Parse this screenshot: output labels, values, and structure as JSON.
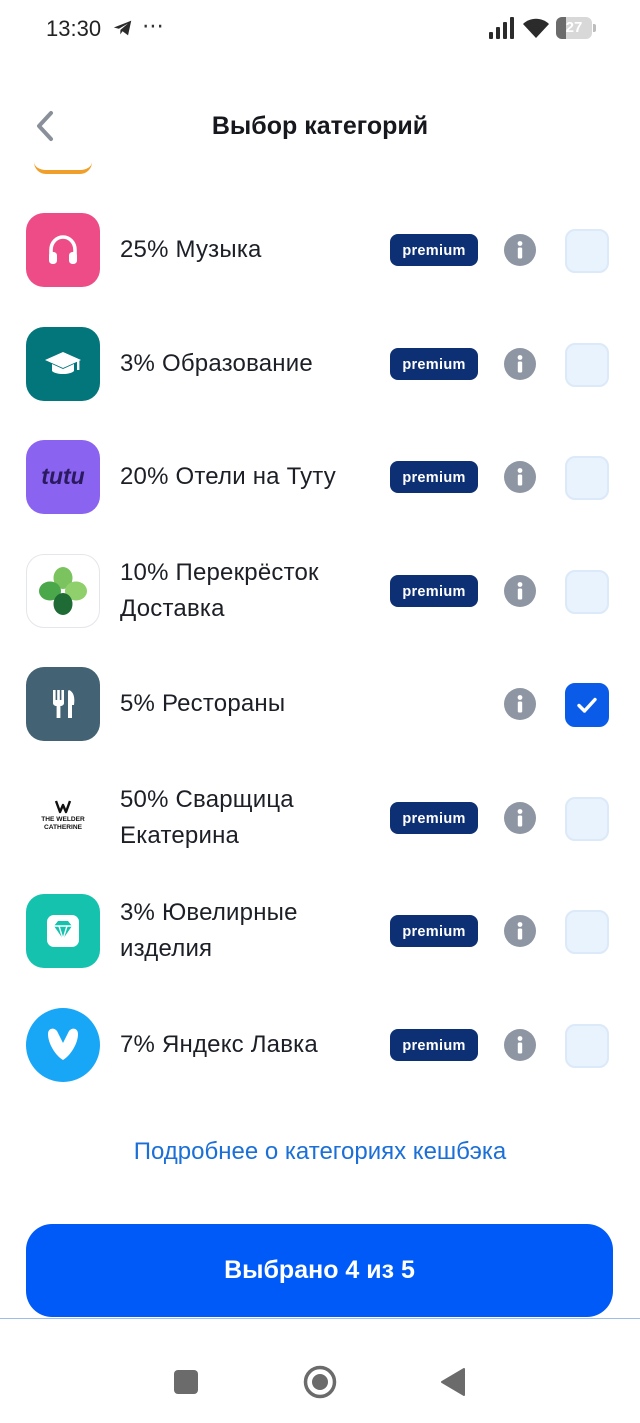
{
  "status_bar": {
    "time": "13:30",
    "more_icon": "⋯",
    "battery_level": "27",
    "battery_fraction": 0.27,
    "icons": [
      "telegram-icon",
      "more-dots-icon",
      "signal-icon",
      "wifi-icon",
      "battery-icon"
    ]
  },
  "header": {
    "title": "Выбор категорий",
    "back_icon": "chevron-left-icon"
  },
  "categories": [
    {
      "label": "25% Музыка",
      "icon": "headphones-icon",
      "icon_bg": "#ee4c87",
      "premium": true,
      "checked": false
    },
    {
      "label": "3% Образование",
      "icon": "graduation-cap-icon",
      "icon_bg": "#02767a",
      "premium": true,
      "checked": false
    },
    {
      "label": "20% Отели на Туту",
      "icon": "tutu-logo",
      "icon_text": "tutu",
      "icon_bg": "#8b63f1",
      "premium": true,
      "checked": false
    },
    {
      "label": "10% Перекрёсток Доставка",
      "icon": "perekrestok-clover-icon",
      "icon_bg": "#ffffff",
      "premium": true,
      "checked": false
    },
    {
      "label": "5% Рестораны",
      "icon": "fork-knife-icon",
      "icon_bg": "#436273",
      "premium": false,
      "checked": true
    },
    {
      "label": "50% Сварщица Екатерина",
      "icon": "welder-catherine-logo",
      "icon_text_line1": "THE WELDER",
      "icon_text_line2": "CATHERINE",
      "icon_bg": "#ffffff",
      "premium": true,
      "checked": false
    },
    {
      "label": "3% Ювелирные изделия",
      "icon": "diamond-icon",
      "icon_bg": "#14c2ae",
      "premium": true,
      "checked": false
    },
    {
      "label": "7% Яндекс Лавка",
      "icon": "yandex-lavka-icon",
      "icon_bg": "#18a6f7",
      "premium": true,
      "checked": false
    }
  ],
  "premium_badge": {
    "label": "premium"
  },
  "more_link": "Подробнее о категориях кешбэка",
  "selected_button": "Выбрано 4 из 5",
  "colors": {
    "accent": "#005af8",
    "link": "#1b6fd6",
    "premium_bg": "#0d2f73",
    "checkbox_bg": "#e8f3fe",
    "checkbox_checked": "#0a5ce8",
    "info_icon": "#8e96a3"
  }
}
